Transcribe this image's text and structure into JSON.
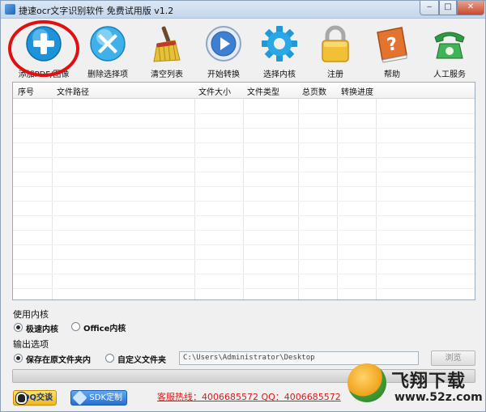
{
  "window": {
    "title": "捷速ocr文字识别软件 免费试用版 v1.2",
    "minimize_symbol": "‒",
    "maximize_symbol": "□",
    "close_symbol": "✕"
  },
  "toolbar": {
    "items": [
      {
        "label": "添加PDF/图像",
        "icon": "plus-icon"
      },
      {
        "label": "删除选择项",
        "icon": "delete-icon"
      },
      {
        "label": "清空列表",
        "icon": "broom-icon"
      },
      {
        "label": "开始转换",
        "icon": "play-icon"
      },
      {
        "label": "选择内核",
        "icon": "gear-icon"
      },
      {
        "label": "注册",
        "icon": "lock-icon"
      },
      {
        "label": "帮助",
        "icon": "help-icon"
      },
      {
        "label": "人工服务",
        "icon": "phone-icon"
      }
    ]
  },
  "table": {
    "headers": [
      "序号",
      "文件路径",
      "文件大小",
      "文件类型",
      "总页数",
      "转换进度"
    ],
    "rows": []
  },
  "engine": {
    "label": "使用内核",
    "options": [
      {
        "label": "极速内核",
        "selected": true
      },
      {
        "label": "Office内核",
        "selected": false
      }
    ]
  },
  "output": {
    "label": "输出选项",
    "options": [
      {
        "label": "保存在原文件夹内",
        "selected": true
      },
      {
        "label": "自定义文件夹",
        "selected": false
      }
    ],
    "path": "C:\\Users\\Administrator\\Desktop",
    "browse_label": "浏览"
  },
  "progress": {
    "value": 0
  },
  "footer": {
    "qq_label": "QQ交谈",
    "sdk_label": "SDK定制",
    "hotline": "客服热线：4006685572 QQ：4006685572"
  },
  "watermark": {
    "title": "飞翔下载",
    "url": "www.52z.com"
  },
  "colors": {
    "accent_blue": "#1f93d9",
    "annotation_red": "#e01010",
    "hotline_red": "#e01818"
  }
}
